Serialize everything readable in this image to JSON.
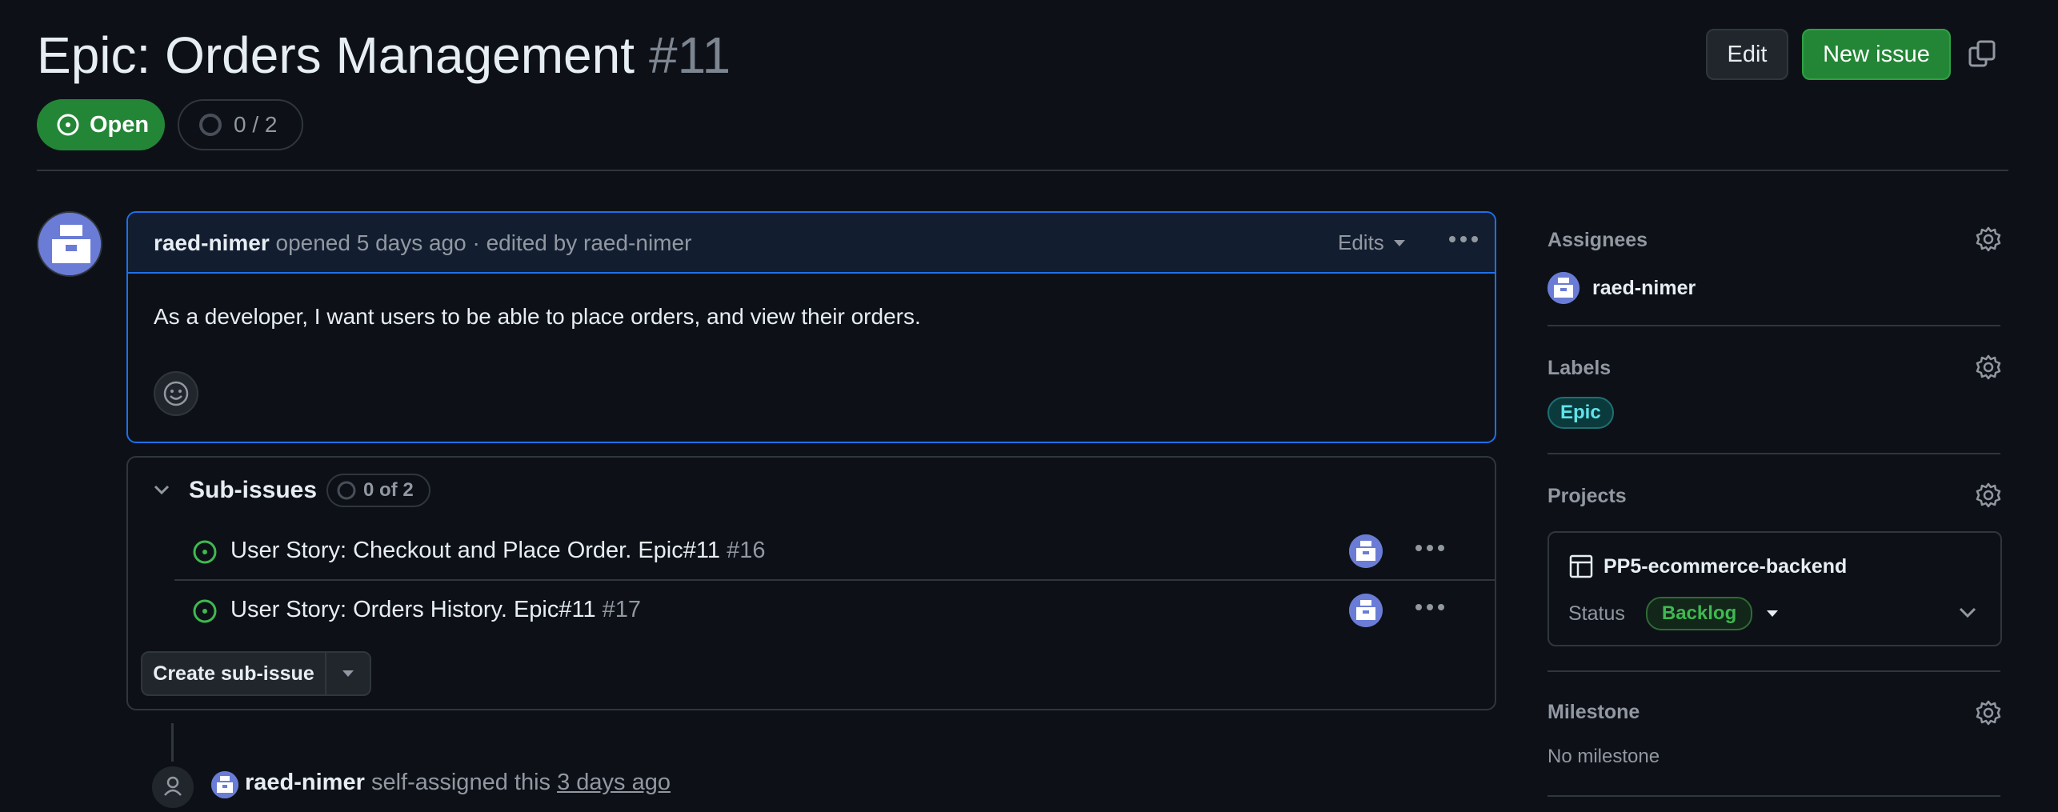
{
  "header": {
    "title": "Epic: Orders Management",
    "number": "#11",
    "edit_label": "Edit",
    "new_issue_label": "New issue",
    "state_label": "Open",
    "progress": "0 / 2"
  },
  "comment": {
    "author": "raed-nimer",
    "meta": "opened 5 days ago · edited by raed-nimer",
    "edits_label": "Edits",
    "body": "As a developer, I want users to be able to place orders, and view their orders."
  },
  "sub_issues": {
    "title": "Sub-issues",
    "count": "0 of 2",
    "items": [
      {
        "title": "User Story: Checkout and Place Order. Epic#11",
        "number": "#16"
      },
      {
        "title": "User Story: Orders History. Epic#11",
        "number": "#17"
      }
    ],
    "create_label": "Create sub-issue"
  },
  "timeline": {
    "actor": "raed-nimer",
    "action": "self-assigned this",
    "time": "3 days ago"
  },
  "sidebar": {
    "assignees_label": "Assignees",
    "assignee": "raed-nimer",
    "labels_label": "Labels",
    "label": "Epic",
    "projects_label": "Projects",
    "project_name": "PP5-ecommerce-backend",
    "status_label": "Status",
    "status_value": "Backlog",
    "milestone_label": "Milestone",
    "milestone_value": "No milestone"
  },
  "colors": {
    "open_green": "#238636",
    "link_blue": "#1f6feb",
    "label_cyan": "#5fe4ea"
  }
}
